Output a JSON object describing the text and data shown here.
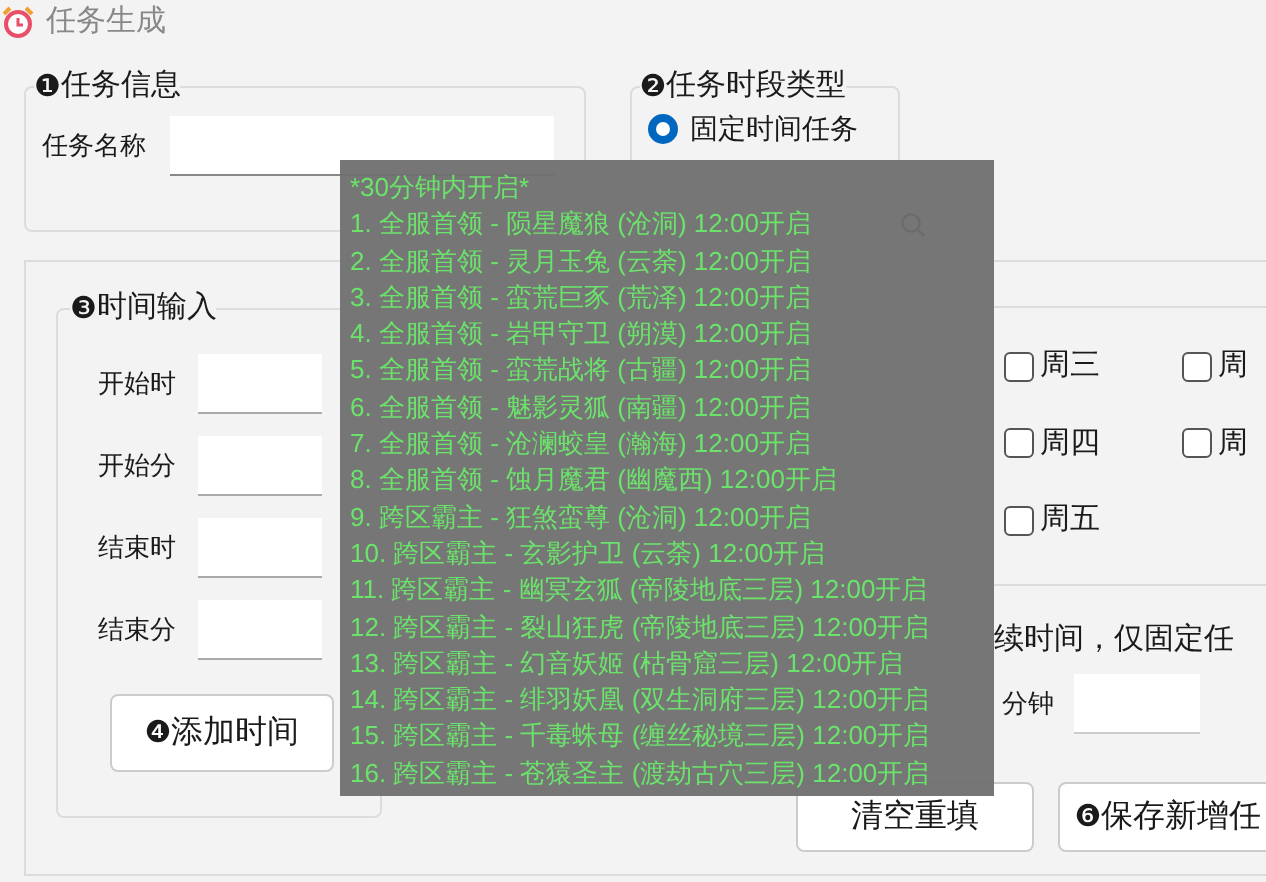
{
  "window": {
    "title": "任务生成"
  },
  "task_info": {
    "legend_number": "❶",
    "legend": "任务信息",
    "name_label": "任务名称"
  },
  "period_type": {
    "legend_number": "❷",
    "legend": "任务时段类型",
    "options": [
      {
        "label": "固定时间任务",
        "selected": true
      }
    ]
  },
  "weekdays": [
    {
      "label": "周三",
      "checked": false
    },
    {
      "label": "周",
      "checked": false
    },
    {
      "label": "周四",
      "checked": false
    },
    {
      "label": "周",
      "checked": false
    },
    {
      "label": "周五",
      "checked": false
    }
  ],
  "time_input": {
    "legend_number": "❸",
    "legend": "时间输入",
    "fields": [
      {
        "label": "开始时"
      },
      {
        "label": "开始分"
      },
      {
        "label": "结束时"
      },
      {
        "label": "结束分"
      }
    ]
  },
  "add_button": {
    "number": "❹",
    "label": "添加时间"
  },
  "duration": {
    "note": "续时间，仅固定任",
    "unit": "分钟"
  },
  "buttons": [
    {
      "label": "清空重填"
    },
    {
      "number": "❻",
      "label": "保存新增任"
    }
  ],
  "tooltip": {
    "lines": [
      "*30分钟内开启*",
      "1. 全服首领 - 陨星魔狼 (沧洞) 12:00开启",
      "2. 全服首领 - 灵月玉兔 (云荼) 12:00开启",
      "3. 全服首领 - 蛮荒巨豕 (荒泽) 12:00开启",
      "4. 全服首领 - 岩甲守卫 (朔漠) 12:00开启",
      "5. 全服首领 - 蛮荒战将 (古疆) 12:00开启",
      "6. 全服首领 - 魅影灵狐 (南疆) 12:00开启",
      "7. 全服首领 - 沧澜蛟皇 (瀚海) 12:00开启",
      "8. 全服首领 - 蚀月魔君 (幽魔西) 12:00开启",
      "9. 跨区霸主 - 狂煞蛮尊 (沧洞) 12:00开启",
      "10. 跨区霸主 - 玄影护卫 (云荼) 12:00开启",
      "11. 跨区霸主 - 幽冥玄狐 (帝陵地底三层) 12:00开启",
      "12. 跨区霸主 - 裂山狂虎 (帝陵地底三层) 12:00开启",
      "13. 跨区霸主 - 幻音妖姬 (枯骨窟三层) 12:00开启",
      "14. 跨区霸主 - 绯羽妖凰 (双生洞府三层) 12:00开启",
      "15. 跨区霸主 - 千毒蛛母 (缠丝秘境三层) 12:00开启",
      "16. 跨区霸主 - 苍猿圣主 (渡劫古穴三层) 12:00开启"
    ]
  }
}
